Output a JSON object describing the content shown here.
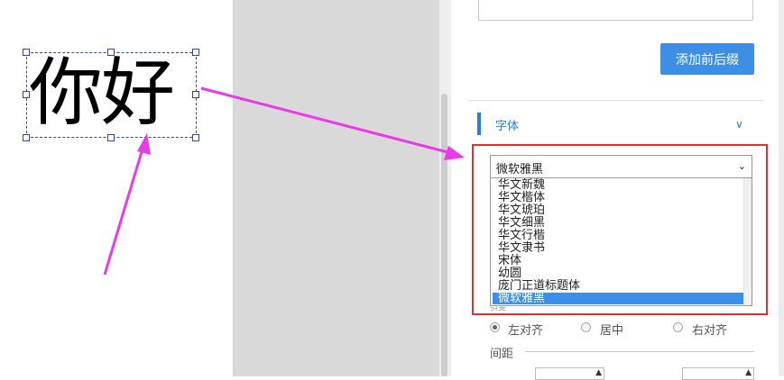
{
  "canvas": {
    "sample_text": "你好"
  },
  "panel": {
    "add_prefix_suffix_button": "添加前后缀",
    "font_section_title": "字体",
    "font_select": {
      "selected": "微软雅黑",
      "options": [
        "华文新魏",
        "华文楷体",
        "华文琥珀",
        "华文细黑",
        "华文行楷",
        "华文隶书",
        "宋体",
        "幼圆",
        "庞门正道标题体",
        "微软雅黑"
      ]
    },
    "align_label_partial": "对齐",
    "align": {
      "left": "左对齐",
      "center": "居中",
      "right": "右对齐"
    },
    "spacing_label": "间距"
  },
  "colors": {
    "accent": "#2a7fd4",
    "button": "#3d8fe6",
    "highlight_border": "#e03030",
    "annotation_arrow": "#e83ae8",
    "selected_option": "#3b8fea"
  }
}
